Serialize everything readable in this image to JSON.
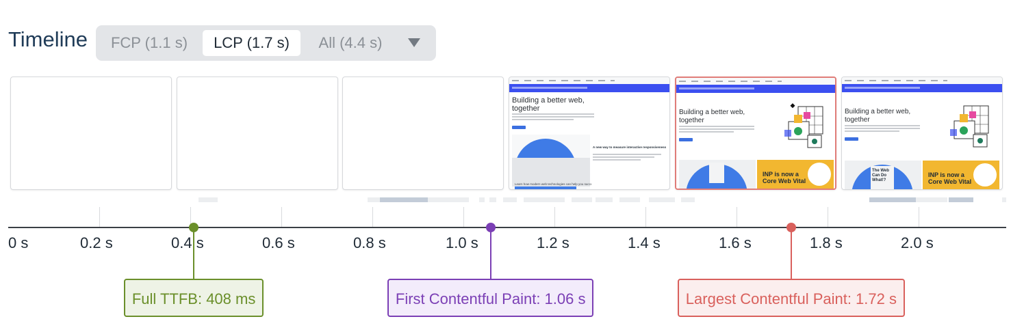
{
  "header": {
    "title": "Timeline",
    "options": [
      "FCP (1.1 s)",
      "LCP (1.7 s)",
      "All (4.4 s)"
    ],
    "selected": "LCP (1.7 s)"
  },
  "filmstrip": {
    "frames": [
      {
        "state": "blank"
      },
      {
        "state": "blank"
      },
      {
        "state": "blank"
      },
      {
        "state": "partial",
        "heading": "Building a better web,\ntogether",
        "card_title": "A new way to measure interactive responsiveness",
        "card_caption": "Learn how modern web technologies can help you succeed"
      },
      {
        "state": "lcp",
        "heading": "Building a better web,\ntogether",
        "promo_text": "INP is now a\nCore Web Vital"
      },
      {
        "state": "final",
        "heading": "Building a better web,\ntogether",
        "promo_text": "INP is now a\nCore Web Vital",
        "hill_text": "The Web\nCan Do\nWhat!?"
      }
    ]
  },
  "axis": {
    "ticks": [
      "0 s",
      "0.2 s",
      "0.4 s",
      "0.6 s",
      "0.8 s",
      "1.0 s",
      "1.2 s",
      "1.4 s",
      "1.6 s",
      "1.8 s",
      "2.0 s"
    ]
  },
  "markers": [
    {
      "label": "Full TTFB: 408 ms",
      "time_s": 0.408,
      "color": "#6a8f2a",
      "bg": "#eef3e6"
    },
    {
      "label": "First Contentful Paint: 1.06 s",
      "time_s": 1.06,
      "color": "#7b3fb5",
      "bg": "#f3ecfb"
    },
    {
      "label": "Largest Contentful Paint: 1.72 s",
      "time_s": 1.72,
      "color": "#d9605c",
      "bg": "#fbeeee"
    }
  ],
  "colors": {
    "accent_lcp": "#e07c78",
    "blue_banner": "#3b4ff0",
    "yellow_card": "#f2b730"
  }
}
